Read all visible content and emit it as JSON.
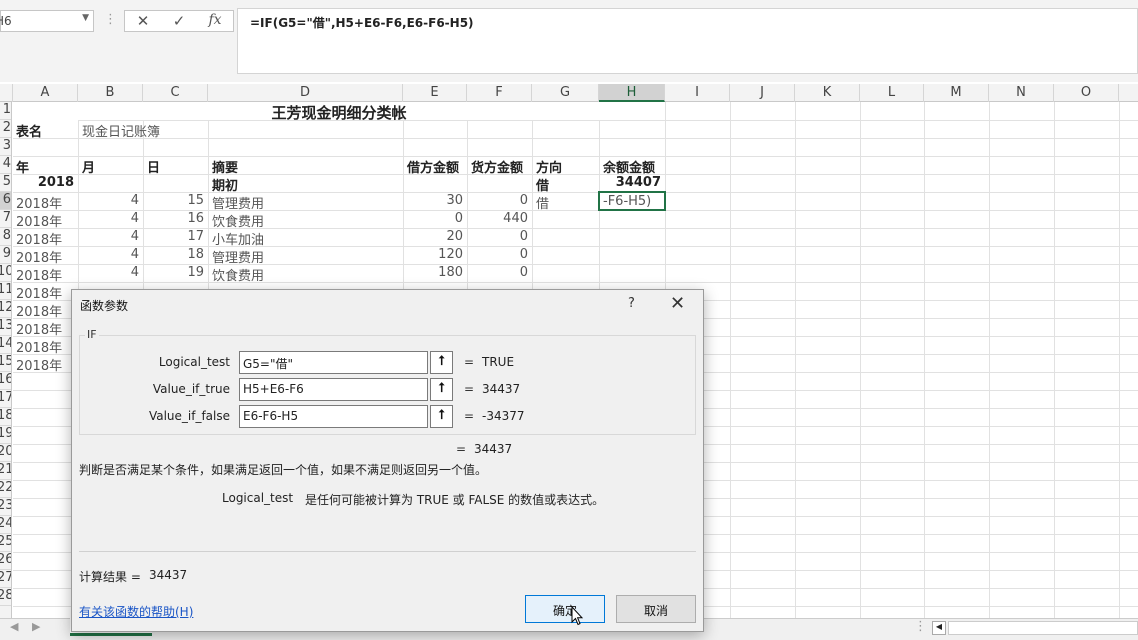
{
  "formula_bar": {
    "name_box": "H6",
    "cancel_icon": "✕",
    "enter_icon": "✓",
    "fx_label": "fx",
    "formula": "=IF(G5=\"借\",H5+E6-F6,E6-F6-H5)"
  },
  "columns": [
    "A",
    "B",
    "C",
    "D",
    "E",
    "F",
    "G",
    "H",
    "I",
    "J",
    "K",
    "L",
    "M",
    "N",
    "O"
  ],
  "rows": [
    "1",
    "2",
    "3",
    "4",
    "5",
    "6",
    "7",
    "8",
    "9",
    "10",
    "11",
    "12",
    "13",
    "14",
    "15",
    "16",
    "17",
    "18",
    "19",
    "20",
    "21",
    "22",
    "23",
    "24",
    "25",
    "26",
    "27",
    "28"
  ],
  "sheet": {
    "title": "王芳现金明细分类帐",
    "r2": {
      "a": "表名",
      "b": "现金日记账簿"
    },
    "headers": {
      "a": "年",
      "b": "月",
      "c": "日",
      "d": "摘要",
      "e": "借方金额",
      "f": "货方金额",
      "g": "方向",
      "h": "余额金额"
    },
    "r5": {
      "a": "2018",
      "d": "期初",
      "g": "借",
      "h": "34407"
    },
    "data_rows": [
      {
        "a": "2018年",
        "b": "4",
        "c": "15",
        "d": "管理费用",
        "e": "30",
        "f": "0",
        "g": "借",
        "h": "-F6-H5)"
      },
      {
        "a": "2018年",
        "b": "4",
        "c": "16",
        "d": "饮食费用",
        "e": "0",
        "f": "440",
        "g": "",
        "h": ""
      },
      {
        "a": "2018年",
        "b": "4",
        "c": "17",
        "d": "小车加油",
        "e": "20",
        "f": "0",
        "g": "",
        "h": ""
      },
      {
        "a": "2018年",
        "b": "4",
        "c": "18",
        "d": "管理费用",
        "e": "120",
        "f": "0",
        "g": "",
        "h": ""
      },
      {
        "a": "2018年",
        "b": "4",
        "c": "19",
        "d": "饮食费用",
        "e": "180",
        "f": "0",
        "g": "",
        "h": ""
      }
    ],
    "extra_years": [
      "2018年",
      "2018年",
      "2018年",
      "2018年",
      "2018年"
    ]
  },
  "dialog": {
    "title": "函数参数",
    "help": "?",
    "close": "✕",
    "function_name": "IF",
    "args": [
      {
        "label": "Logical_test",
        "value": "G5=\"借\"",
        "result": "TRUE"
      },
      {
        "label": "Value_if_true",
        "value": "H5+E6-F6",
        "result": "34437"
      },
      {
        "label": "Value_if_false",
        "value": "E6-F6-H5",
        "result": "-34377"
      }
    ],
    "equals": "=",
    "overall_result": "34437",
    "description": "判断是否满足某个条件，如果满足返回一个值，如果不满足则返回另一个值。",
    "arg_name": "Logical_test",
    "arg_description": "是任何可能被计算为 TRUE 或 FALSE 的数值或表达式。",
    "calc_label": "计算结果 =",
    "calc_value": "34437",
    "help_link": "有关该函数的帮助(H)",
    "ok": "确定",
    "cancel": "取消",
    "collapse_icon": "arrow-up-collapse-icon"
  },
  "colors": {
    "accent": "#217346",
    "link": "#1a55c6",
    "ok_border": "#0078d7"
  }
}
